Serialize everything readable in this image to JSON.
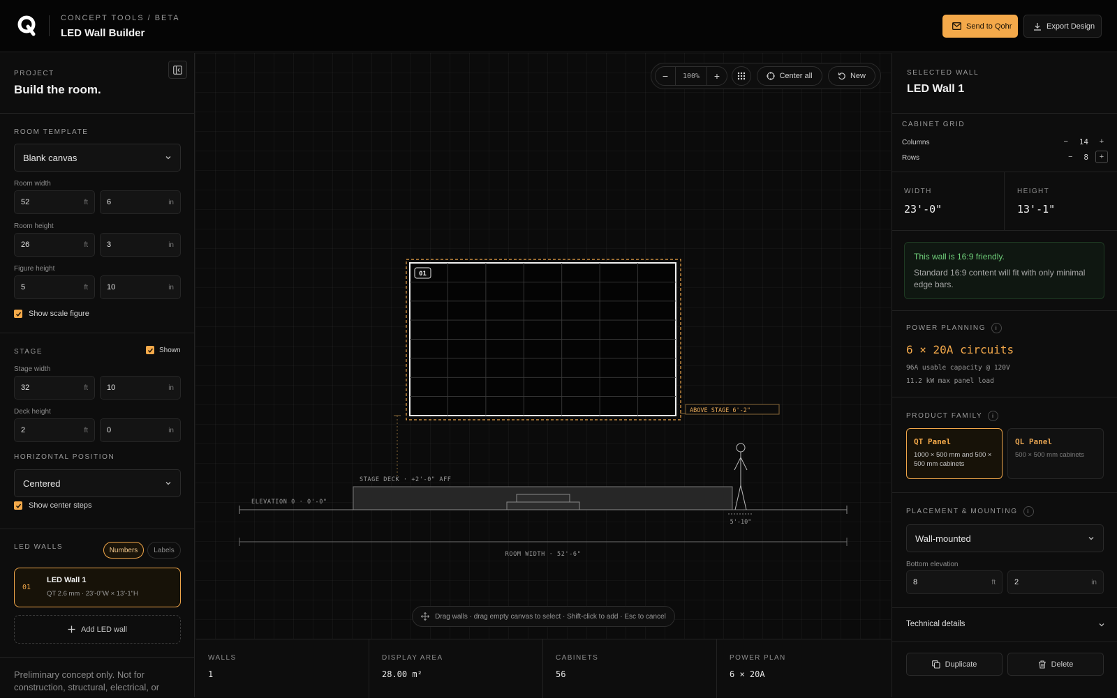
{
  "header": {
    "kicker": "CONCEPT TOOLS / BETA",
    "title": "LED Wall Builder",
    "send_label": "Send to Qohr",
    "export_label": "Export Design"
  },
  "left": {
    "project_kicker": "PROJECT",
    "project_title": "Build the room.",
    "room_template": {
      "title": "ROOM TEMPLATE",
      "value": "Blank canvas",
      "room_width_label": "Room width",
      "room_width_ft": "52",
      "room_width_in": "6",
      "room_height_label": "Room height",
      "room_height_ft": "26",
      "room_height_in": "3",
      "figure_height_label": "Figure height",
      "figure_height_ft": "5",
      "figure_height_in": "10",
      "show_scale_label": "Show scale figure"
    },
    "stage": {
      "title": "STAGE",
      "shown_label": "Shown",
      "stage_width_label": "Stage width",
      "stage_width_ft": "32",
      "stage_width_in": "10",
      "deck_height_label": "Deck height",
      "deck_height_ft": "2",
      "deck_height_in": "0",
      "hpos_title": "HORIZONTAL POSITION",
      "hpos_value": "Centered",
      "show_steps_label": "Show center steps"
    },
    "units": {
      "ft": "ft",
      "in": "in"
    },
    "led_walls": {
      "title": "LED WALLS",
      "numbers_label": "Numbers",
      "labels_label": "Labels",
      "walls": [
        {
          "num": "01",
          "name": "LED Wall 1",
          "detail": "QT 2.6 mm · 23'-0\"W × 13'-1\"H"
        }
      ],
      "add_label": "Add LED wall"
    },
    "disclaimer": "Preliminary concept only. Not for construction, structural, electrical, or"
  },
  "canvas": {
    "zoom": "100%",
    "center_label": "Center all",
    "new_label": "New",
    "wall_badge": "01",
    "above_stage": "ABOVE STAGE 6'-2\"",
    "stage_deck": "STAGE DECK · +2'-0\" AFF",
    "elevation": "ELEVATION 0 · 0'-0\"",
    "figure_height": "5'-10\"",
    "room_width": "ROOM WIDTH · 52'-6\"",
    "hint": "Drag walls · drag empty canvas to select · Shift-click to add · Esc to cancel"
  },
  "stats": [
    {
      "label": "WALLS",
      "value": "1"
    },
    {
      "label": "DISPLAY AREA",
      "value": "28.00 m²"
    },
    {
      "label": "CABINETS",
      "value": "56"
    },
    {
      "label": "POWER PLAN",
      "value": "6 × 20A"
    }
  ],
  "right": {
    "selected_kicker": "SELECTED WALL",
    "selected_title": "LED Wall 1",
    "cabinet_grid_title": "CABINET GRID",
    "columns_label": "Columns",
    "columns": "14",
    "rows_label": "Rows",
    "rows": "8",
    "width_label": "WIDTH",
    "width_value": "23'-0\"",
    "height_label": "HEIGHT",
    "height_value": "13'-1\"",
    "ratio_title": "This wall is 16:9 friendly.",
    "ratio_text": "Standard 16:9 content will fit with only minimal edge bars.",
    "power_title": "POWER PLANNING",
    "power_value": "6 × 20A circuits",
    "power_line1": "96A usable capacity @ 120V",
    "power_line2": "11.2 kW max panel load",
    "product_title": "PRODUCT FAMILY",
    "products": [
      {
        "name": "QT Panel",
        "desc": "1000 × 500 mm and 500 × 500 mm cabinets"
      },
      {
        "name": "QL Panel",
        "desc": "500 × 500 mm cabinets"
      }
    ],
    "placement_title": "PLACEMENT & MOUNTING",
    "placement_value": "Wall-mounted",
    "bottom_elev_label": "Bottom elevation",
    "bottom_elev_ft": "8",
    "bottom_elev_in": "2",
    "tech_label": "Technical details",
    "duplicate_label": "Duplicate",
    "delete_label": "Delete"
  },
  "colors": {
    "accent": "#f4a94a",
    "success": "#6fd07a",
    "background": "#0b0b0b"
  }
}
